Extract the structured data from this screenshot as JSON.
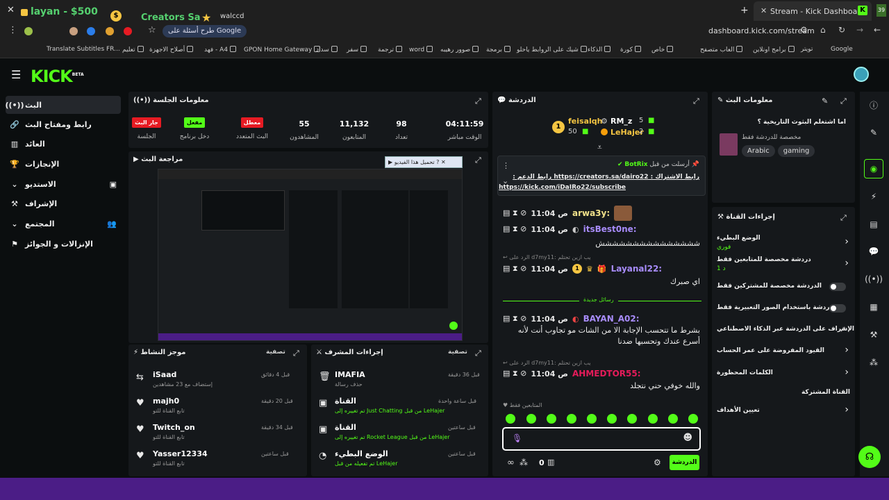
{
  "browser": {
    "overlay_balance": "layan - $500",
    "overlay_title": "Creators Sa -",
    "overlay_extra": "walccd",
    "tab_title": "Stream - Kick Dashboard",
    "address": "dashboard.kick.com/stream",
    "google_prompt": "طرح أسئلة على Google",
    "bookmarks": [
      "Google",
      "تويتر",
      "برامج اونلاين",
      "العاب متصفح",
      "خاص",
      "كورة",
      "الذكاء",
      "شيك على الروابط ياحلو",
      "برمجة",
      "صوور رهيبه",
      "word",
      "ترجمة",
      "سفر",
      "سداد",
      "GPON Home Gateway",
      "فهد - A4",
      "أصلاح الاجهزة",
      "تعليم",
      "Translate Subtitles FR..."
    ]
  },
  "kick": {
    "logo": "KICK",
    "logo_beta": "BETA"
  },
  "sidebar": {
    "items": [
      {
        "label": "البث",
        "icon": "broadcast-icon"
      },
      {
        "label": "رابط ومفتاح البث",
        "icon": "link-icon"
      },
      {
        "label": "العائد",
        "icon": "revenue-icon"
      },
      {
        "label": "الإنجازات",
        "icon": "trophy-icon"
      },
      {
        "label": "الاستديو",
        "icon": "studio-icon"
      },
      {
        "label": "الإشراف",
        "icon": "moderation-icon"
      },
      {
        "label": "المجتمع",
        "icon": "community-icon"
      },
      {
        "label": "الإنزالات و الجوائز",
        "icon": "drops-icon"
      }
    ]
  },
  "session": {
    "title": "معلومات الجلسة",
    "stats": [
      {
        "value": "04:11:59",
        "label": "الوقت مباشر"
      },
      {
        "value": "98",
        "label": "تعداد"
      },
      {
        "value": "11,132",
        "label": "المتابعون"
      },
      {
        "value": "55",
        "label": "المشاهدون"
      }
    ],
    "multistream_label": "البث المتعدد",
    "multistream_state": "معطل",
    "program_label": "دخل برنامج",
    "program_state": "مفعل",
    "session_label": "الجلسة",
    "session_state": "جار البث"
  },
  "preview": {
    "title": "مراجعة البث",
    "dialog": "تحميل هذا الفيديو"
  },
  "chat": {
    "title": "الدردشة",
    "top_users": [
      {
        "name": "feisalqh",
        "count": "50",
        "rank": "1"
      },
      {
        "name": "RM_z",
        "count": "5"
      },
      {
        "name": "LeHajer",
        "count": "2"
      }
    ],
    "pinned": {
      "by": "BotRix",
      "by_label": "أرسلت من قبل",
      "text": "رابط الاشتراك : https://creators.sa/dairo22 رابط الدعم :",
      "link": "https://kick.com/iDaIRo22/subscribe"
    },
    "messages": [
      {
        "time": "11:04 ص",
        "user": "arwa3y:",
        "text": "",
        "color": "#f0e08a"
      },
      {
        "time": "11:04 ص",
        "user": "itsBest0ne:",
        "text": "ششششششششششششششش",
        "color": "#a78bfa"
      },
      {
        "reply": "الرد على d7my11: يب ازين تحتلم"
      },
      {
        "time": "11:04 ص",
        "user": "Layanal22:",
        "text": "اي صبرك",
        "color": "#a78bfa"
      },
      {
        "divider": "رسائل جديدة"
      },
      {
        "time": "11:04 ص",
        "user": "BAYAN_A02:",
        "text": "بشرط ما تتحسب الإجابة الا من الشات مو تجاوب أنت لأنه أسرع عندك وتحسبها ضدنا",
        "color": "#a78bfa"
      },
      {
        "reply": "الرد على d7my11: يب ازين تحتلم"
      },
      {
        "time": "11:04 ص",
        "user": "AHMEDTOR55:",
        "text": "والله خوفي حني نتجلد",
        "color": "#e61b5a"
      }
    ],
    "followers_only": "المتابعين فقط",
    "input_placeholder": "",
    "send_label": "الدردشة",
    "points": "0"
  },
  "stream_info": {
    "title": "معلومات البث",
    "question": "اما اشتغلم البثوث التاريخية ؟",
    "subtitle": "مخصصة للدردشة فقط",
    "tags": [
      "gaming",
      "Arabic"
    ]
  },
  "channel_actions": {
    "title": "إجراءات القناة",
    "items": [
      {
        "label": "الوضع البطيء",
        "sub": "فوري",
        "control": "chevron"
      },
      {
        "label": "دردشة مخصصة للمتابعين فقط",
        "sub": "1 د",
        "control": "chevron"
      },
      {
        "label": "الدردشة مخصصة للمشتركين فقط",
        "control": "toggle"
      },
      {
        "label": "الدردشة باستخدام الصور التعبيرية فقط",
        "control": "toggle"
      },
      {
        "label": "الإشراف على الدردشة عبر الذكاء الاصطناعي",
        "control": "external"
      },
      {
        "label": "القيود المفروضة على عمر الحساب",
        "control": "chevron"
      },
      {
        "label": "الكلمات المحظورة",
        "control": "chevron"
      }
    ],
    "section2": "القناة المشتركة",
    "goals": "تعيين الأهداف"
  },
  "mod_actions": {
    "title": "إجراءات المشرف",
    "filter": "تصفية",
    "items": [
      {
        "user": "IMAFIA",
        "desc": "حذف رسالة",
        "time": "قبل 36 دقيقة"
      },
      {
        "user": "القناة",
        "desc": "تم تغييره إلى Just Chatting من قبل LeHajer",
        "time": "قبل ساعة واحدة"
      },
      {
        "user": "القناة",
        "desc": "تم تغييره إلى Rocket League من قبل LeHajer",
        "time": "قبل ساعتين"
      },
      {
        "user": "الوضع البطيء",
        "desc": "تم تفعيله من قبل LeHajer",
        "time": "قبل ساعتين"
      }
    ]
  },
  "activity": {
    "title": "موجز النشاط",
    "filter": "تصفية",
    "items": [
      {
        "user": "iSaad",
        "desc": "إستضاف مع 23 مشاهدين",
        "time": "قبل 4 دقائق"
      },
      {
        "user": "majh0",
        "desc": "تابع القناة للتو",
        "time": "قبل 20 دقيقة"
      },
      {
        "user": "Twitch_on",
        "desc": "تابع القناة للتو",
        "time": "قبل 34 دقيقة"
      },
      {
        "user": "Yasser12334",
        "desc": "تابع القناة للتو",
        "time": "قبل ساعتين"
      }
    ]
  },
  "colors": {
    "accent": "#53fc18",
    "red": "#e61b23",
    "panel": "#15181b",
    "bg": "#0b0e0f",
    "purple_band": "#4b1d86"
  }
}
